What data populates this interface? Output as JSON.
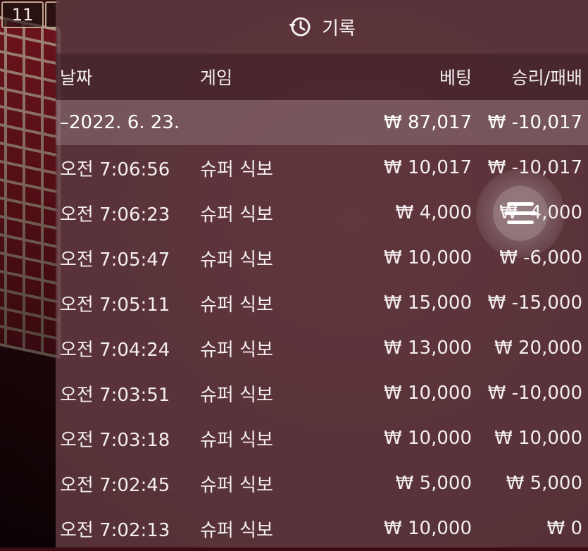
{
  "round_badge": "11",
  "panel": {
    "title": "기록",
    "title_icon": "history-icon"
  },
  "columns": {
    "date": "날짜",
    "game": "게임",
    "bet": "베팅",
    "result": "승리/패배"
  },
  "day_group": {
    "date": "–2022. 6. 23.",
    "total_bet": "₩ 87,017",
    "total_result": "₩ -10,017"
  },
  "rows": [
    {
      "time": "오전 7:06:56",
      "game": "슈퍼 식보",
      "bet": "₩ 10,017",
      "result": "₩ -10,017"
    },
    {
      "time": "오전 7:06:23",
      "game": "슈퍼 식보",
      "bet": "₩ 4,000",
      "result": "₩ -4,000"
    },
    {
      "time": "오전 7:05:47",
      "game": "슈퍼 식보",
      "bet": "₩ 10,000",
      "result": "₩ -6,000"
    },
    {
      "time": "오전 7:05:11",
      "game": "슈퍼 식보",
      "bet": "₩ 15,000",
      "result": "₩ -15,000"
    },
    {
      "time": "오전 7:04:24",
      "game": "슈퍼 식보",
      "bet": "₩ 13,000",
      "result": "₩ 20,000"
    },
    {
      "time": "오전 7:03:51",
      "game": "슈퍼 식보",
      "bet": "₩ 10,000",
      "result": "₩ -10,000"
    },
    {
      "time": "오전 7:03:18",
      "game": "슈퍼 식보",
      "bet": "₩ 10,000",
      "result": "₩ 10,000"
    },
    {
      "time": "오전 7:02:45",
      "game": "슈퍼 식보",
      "bet": "₩ 5,000",
      "result": "₩ 5,000"
    },
    {
      "time": "오전 7:02:13",
      "game": "슈퍼 식보",
      "bet": "₩ 10,000",
      "result": "₩ 0"
    }
  ],
  "menu_button": {
    "icon": "menu-icon"
  }
}
